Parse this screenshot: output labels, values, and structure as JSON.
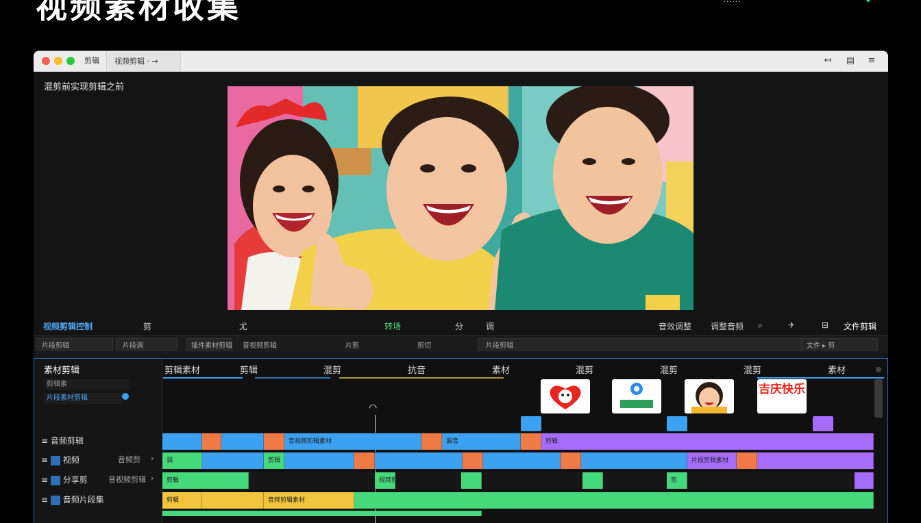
{
  "page": {
    "title": "视频素材收集",
    "top_right_text": "……",
    "accent": "#2e6fb8",
    "check_color": "#28c76f"
  },
  "window": {
    "tabs": [
      "剪辑",
      "视频剪辑 · →"
    ],
    "toolbar_icons": [
      "share-icon",
      "library-icon",
      "menu-icon"
    ]
  },
  "preview": {
    "caption": "混剪前实现剪辑之前"
  },
  "controls": {
    "left_label": "视频剪辑控制",
    "labels": [
      "剪",
      "尤",
      "转场",
      "分",
      "调",
      "音效调整",
      "调整音频",
      "文件剪辑"
    ]
  },
  "sub_bar": {
    "labels": [
      "片段剪辑",
      "片段调",
      "插件素材剪辑",
      "音视频剪辑",
      "片剪",
      "剪切",
      "片段剪辑",
      "文件 ▸ 剪"
    ]
  },
  "timeline": {
    "panel_title": "素材剪辑",
    "panel_items": [
      "剪辑素",
      "片段素材剪辑"
    ],
    "headers": [
      "剪辑素材",
      "剪辑",
      "混剪",
      "抗音",
      "素材",
      "混剪",
      "混剪",
      "混剪",
      "素材"
    ],
    "stickers": [
      "sticker-heart",
      "sticker-face",
      "sticker-girl",
      "sticker-text"
    ],
    "sticker_text": "吉庆快乐",
    "tracks": [
      {
        "label": "音频剪辑",
        "sub": ""
      },
      {
        "label": "视频",
        "sub": "音频剪"
      },
      {
        "label": "分享剪",
        "sub": "音视频剪辑"
      },
      {
        "label": "音频片段集",
        "sub": ""
      }
    ],
    "clip_labels": [
      "音视频剪辑素材",
      "调音",
      "剪辑",
      "调",
      "剪辑",
      "片段剪辑素材",
      "剪辑",
      "视频剪",
      "剪",
      "剪辑",
      "音频剪辑素材"
    ],
    "colors": {
      "blue": "#3ba1f0",
      "orange": "#f07a45",
      "purple": "#a66cff",
      "green": "#45d97c",
      "yellow": "#f2c43d"
    }
  }
}
